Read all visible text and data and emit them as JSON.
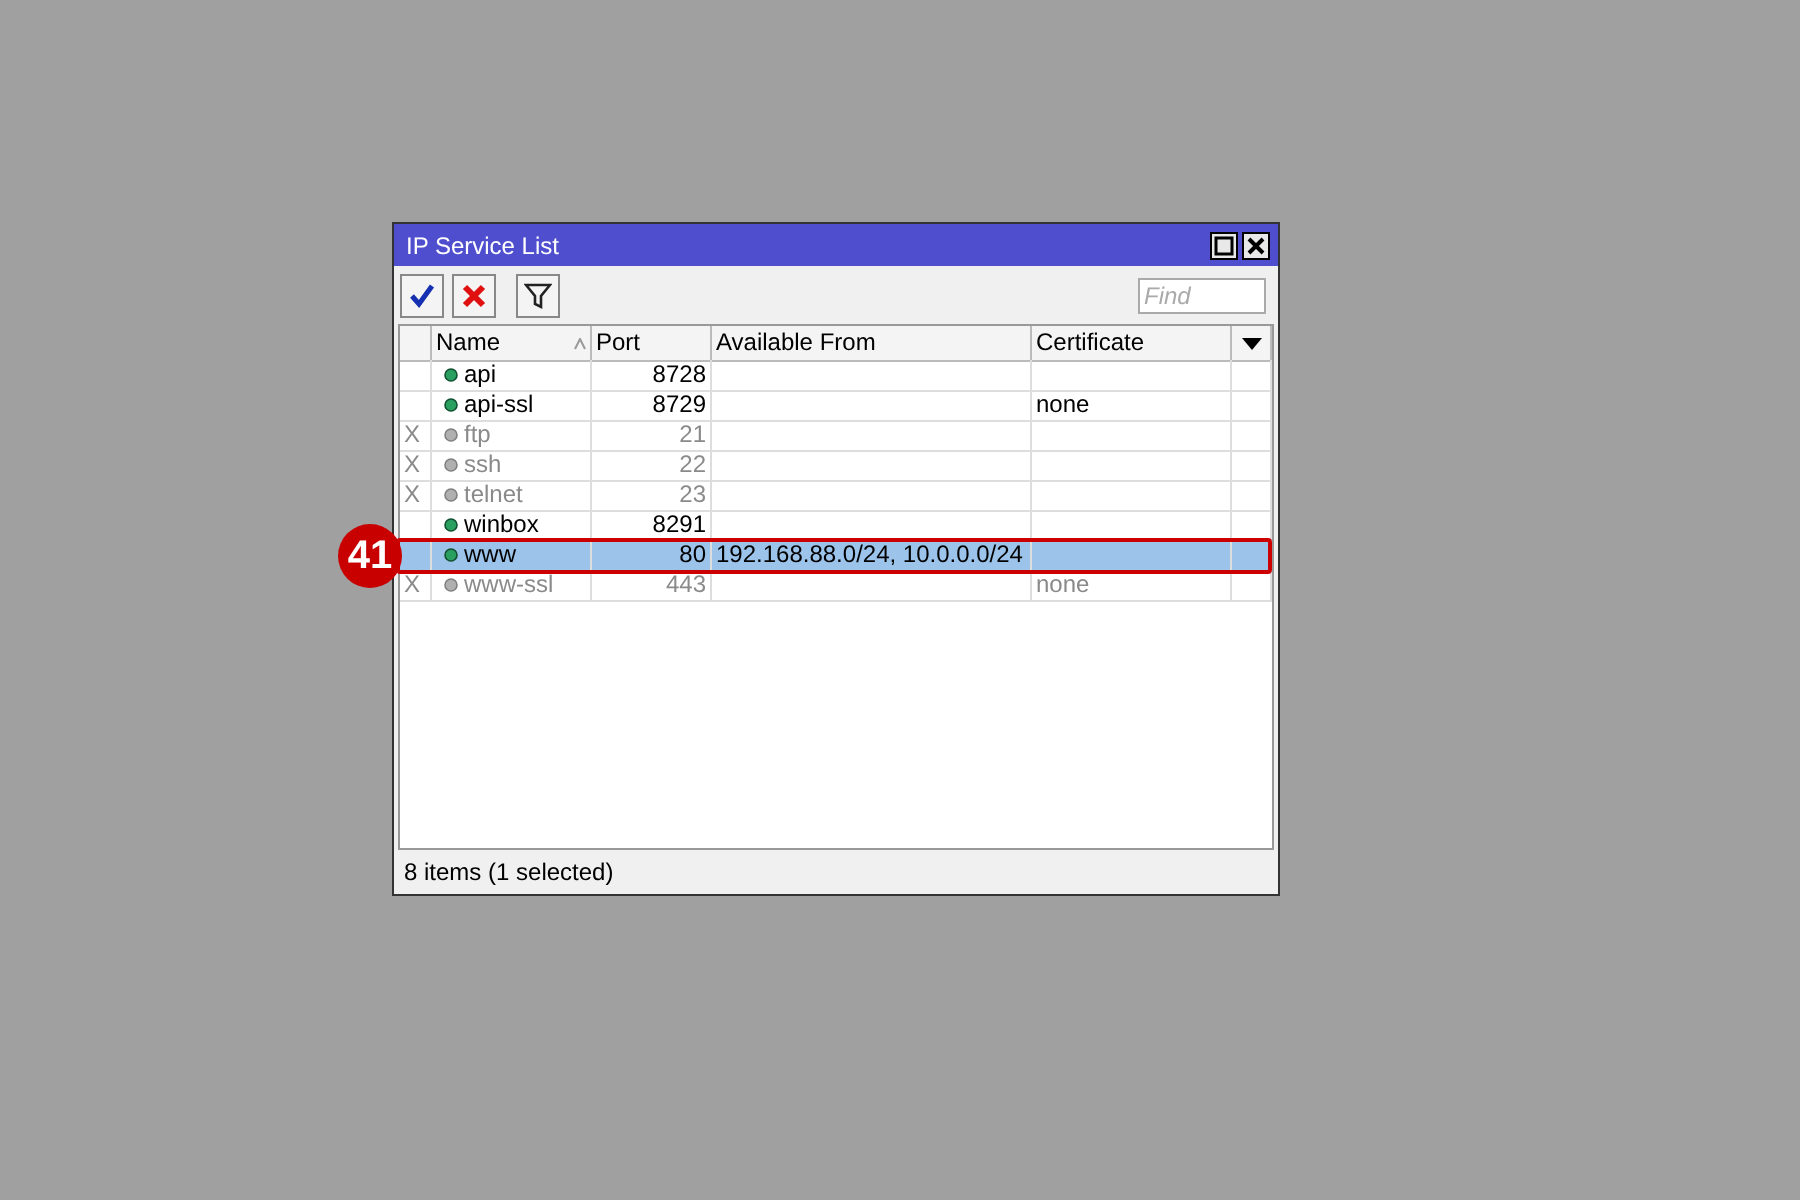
{
  "window": {
    "title": "IP Service List"
  },
  "toolbar": {
    "find": {
      "placeholder": "Find"
    }
  },
  "table": {
    "columns": [
      {
        "label": "Name",
        "sorted": true
      },
      {
        "label": "Port",
        "sorted": false
      },
      {
        "label": "Available From",
        "sorted": false
      },
      {
        "label": "Certificate",
        "sorted": false
      }
    ],
    "rows": [
      {
        "flag": "",
        "name": "api",
        "port": "8728",
        "available_from": "",
        "certificate": "",
        "disabled": false,
        "selected": false
      },
      {
        "flag": "",
        "name": "api-ssl",
        "port": "8729",
        "available_from": "",
        "certificate": "none",
        "disabled": false,
        "selected": false
      },
      {
        "flag": "X",
        "name": "ftp",
        "port": "21",
        "available_from": "",
        "certificate": "",
        "disabled": true,
        "selected": false
      },
      {
        "flag": "X",
        "name": "ssh",
        "port": "22",
        "available_from": "",
        "certificate": "",
        "disabled": true,
        "selected": false
      },
      {
        "flag": "X",
        "name": "telnet",
        "port": "23",
        "available_from": "",
        "certificate": "",
        "disabled": true,
        "selected": false
      },
      {
        "flag": "",
        "name": "winbox",
        "port": "8291",
        "available_from": "",
        "certificate": "",
        "disabled": false,
        "selected": false
      },
      {
        "flag": "",
        "name": "www",
        "port": "80",
        "available_from": "192.168.88.0/24, 10.0.0.0/24",
        "certificate": "",
        "disabled": false,
        "selected": true
      },
      {
        "flag": "X",
        "name": "www-ssl",
        "port": "443",
        "available_from": "",
        "certificate": "none",
        "disabled": true,
        "selected": false
      }
    ]
  },
  "status_bar": "8 items (1 selected)",
  "callout": {
    "label": "41"
  }
}
